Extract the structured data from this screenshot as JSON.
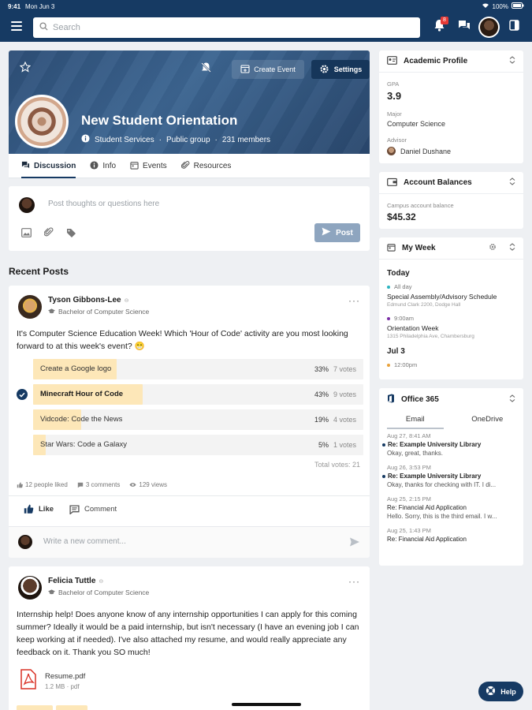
{
  "status_bar": {
    "time": "9:41",
    "date": "Mon Jun 3",
    "battery": "100%"
  },
  "top_bar": {
    "search_placeholder": "Search",
    "notification_count": "8"
  },
  "group": {
    "title": "New Student Orientation",
    "department": "Student Services",
    "visibility": "Public group",
    "members": "231 members",
    "create_event_label": "Create Event",
    "settings_label": "Settings"
  },
  "tabs": [
    {
      "label": "Discussion",
      "icon": "discussion-icon"
    },
    {
      "label": "Info",
      "icon": "info-icon"
    },
    {
      "label": "Events",
      "icon": "calendar-icon"
    },
    {
      "label": "Resources",
      "icon": "paperclip-icon"
    }
  ],
  "composer": {
    "placeholder": "Post thoughts or questions here",
    "post_label": "Post"
  },
  "recent_posts_title": "Recent Posts",
  "posts": [
    {
      "author": "Tyson Gibbons-Lee",
      "program": "Bachelor of Computer Science",
      "body": "It's Computer Science Education Week! Which 'Hour of Code' activity are you most looking forward to at this week's event? 😁",
      "poll": [
        {
          "label": "Create a Google logo",
          "percent": "33%",
          "votes": "7 votes",
          "share": 0.33,
          "selected": false
        },
        {
          "label": "Minecraft Hour of Code",
          "percent": "43%",
          "votes": "9 votes",
          "share": 0.43,
          "selected": true
        },
        {
          "label": "Vidcode: Code the News",
          "percent": "19%",
          "votes": "4 votes",
          "share": 0.19,
          "selected": false
        },
        {
          "label": "Star Wars: Code a Galaxy",
          "percent": "5%",
          "votes": "1 votes",
          "share": 0.05,
          "selected": false
        }
      ],
      "total_votes": "Total votes: 21",
      "likes": "12 people liked",
      "comments": "3 comments",
      "views": "129 views",
      "like_label": "Like",
      "comment_label": "Comment",
      "comment_placeholder": "Write a new comment..."
    },
    {
      "author": "Felicia Tuttle",
      "program": "Bachelor of Computer Science",
      "body": "Internship help! Does anyone know of any internship opportunities I can apply for this coming summer? Ideally it would be a paid internship, but isn't necessary (I have an evening job I can keep working at if needed). I've also attached my resume, and would really appreciate any feedback on it. Thank you SO much!",
      "attachment_name": "Resume.pdf",
      "attachment_meta": "1.2 MB · pdf"
    }
  ],
  "academic_profile": {
    "title": "Academic Profile",
    "gpa_label": "GPA",
    "gpa": "3.9",
    "major_label": "Major",
    "major": "Computer Science",
    "advisor_label": "Advisor",
    "advisor": "Daniel Dushane"
  },
  "account_balances": {
    "title": "Account Balances",
    "label": "Campus account balance",
    "value": "$45.32"
  },
  "my_week": {
    "title": "My Week",
    "today_label": "Today",
    "events": [
      {
        "time": "All day",
        "title": "Special Assembly/Advisory Schedule",
        "location": "Edmund Clark 2200, Dodge Hall",
        "color": "#2bb3c0"
      },
      {
        "time": "9:00am",
        "title": "Orientation Week",
        "location": "1315 Philadelphia Ave, Chambersburg",
        "color": "#7b2fa6"
      }
    ],
    "next_day_label": "Jul 3",
    "next_events": [
      {
        "time": "12:00pm",
        "color": "#e9a23b"
      }
    ]
  },
  "office365": {
    "title": "Office 365",
    "tab_email": "Email",
    "tab_onedrive": "OneDrive",
    "emails": [
      {
        "date": "Aug 27, 8:41 AM",
        "subject": "Re: Example University Library",
        "preview": "Okay, great, thanks.",
        "unread": true
      },
      {
        "date": "Aug 26, 3:53 PM",
        "subject": "Re: Example University Library",
        "preview": "Okay, thanks for checking with IT. I di...",
        "unread": true
      },
      {
        "date": "Aug 25, 2:15 PM",
        "subject": "Re: Financial Aid Application",
        "preview": "Hello. Sorry, this is the third email. I w...",
        "unread": false
      },
      {
        "date": "Aug 25, 1:43 PM",
        "subject": "Re: Financial Aid Application",
        "preview": "",
        "unread": false
      }
    ]
  },
  "help_label": "Help",
  "colors": {
    "navy": "#163a63",
    "poll_fill": "#fde7b8",
    "post_button": "#8ea5bf"
  }
}
